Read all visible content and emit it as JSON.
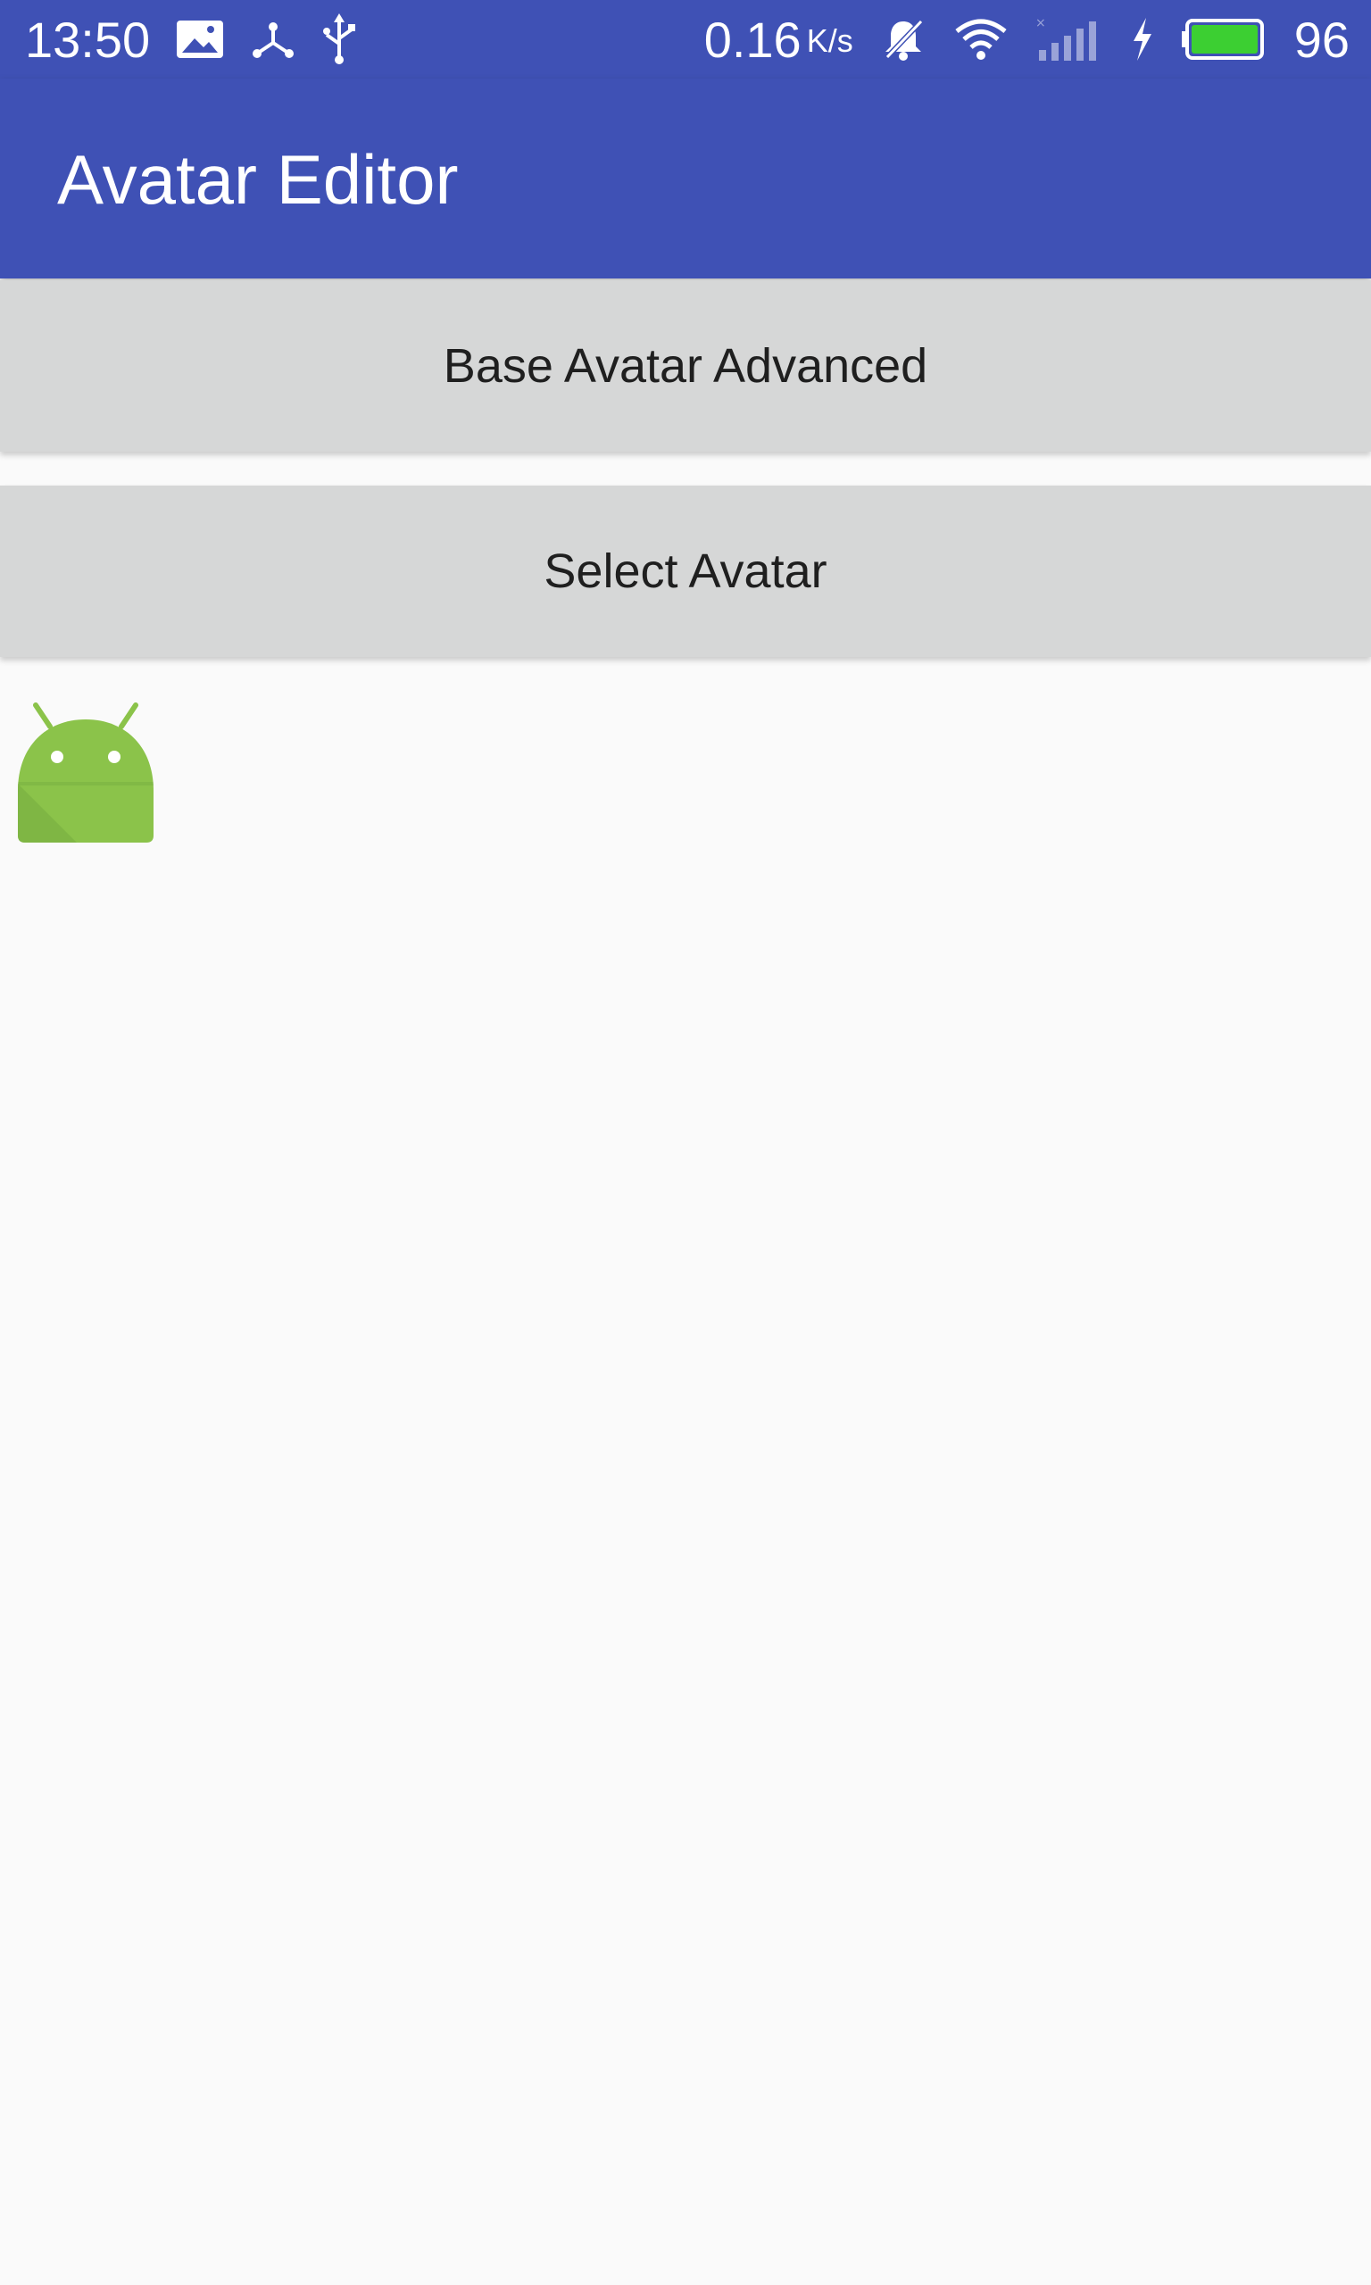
{
  "status_bar": {
    "time": "13:50",
    "net_speed": "0.16",
    "net_unit": "K/s",
    "battery_percent": "96",
    "icons": [
      "image-icon",
      "share-hub-icon",
      "usb-icon",
      "mute-bell-icon",
      "wifi-icon",
      "signal-icon",
      "charging-icon",
      "battery-icon"
    ],
    "battery_level": 0.96,
    "battery_color": "#3ccf32"
  },
  "app_bar": {
    "title": "Avatar Editor",
    "color": "#3f51b5"
  },
  "buttons": {
    "base_avatar_advanced": "Base Avatar Advanced",
    "select_avatar": "Select Avatar"
  },
  "avatar": {
    "icon": "android-icon",
    "color": "#8bc34a"
  }
}
